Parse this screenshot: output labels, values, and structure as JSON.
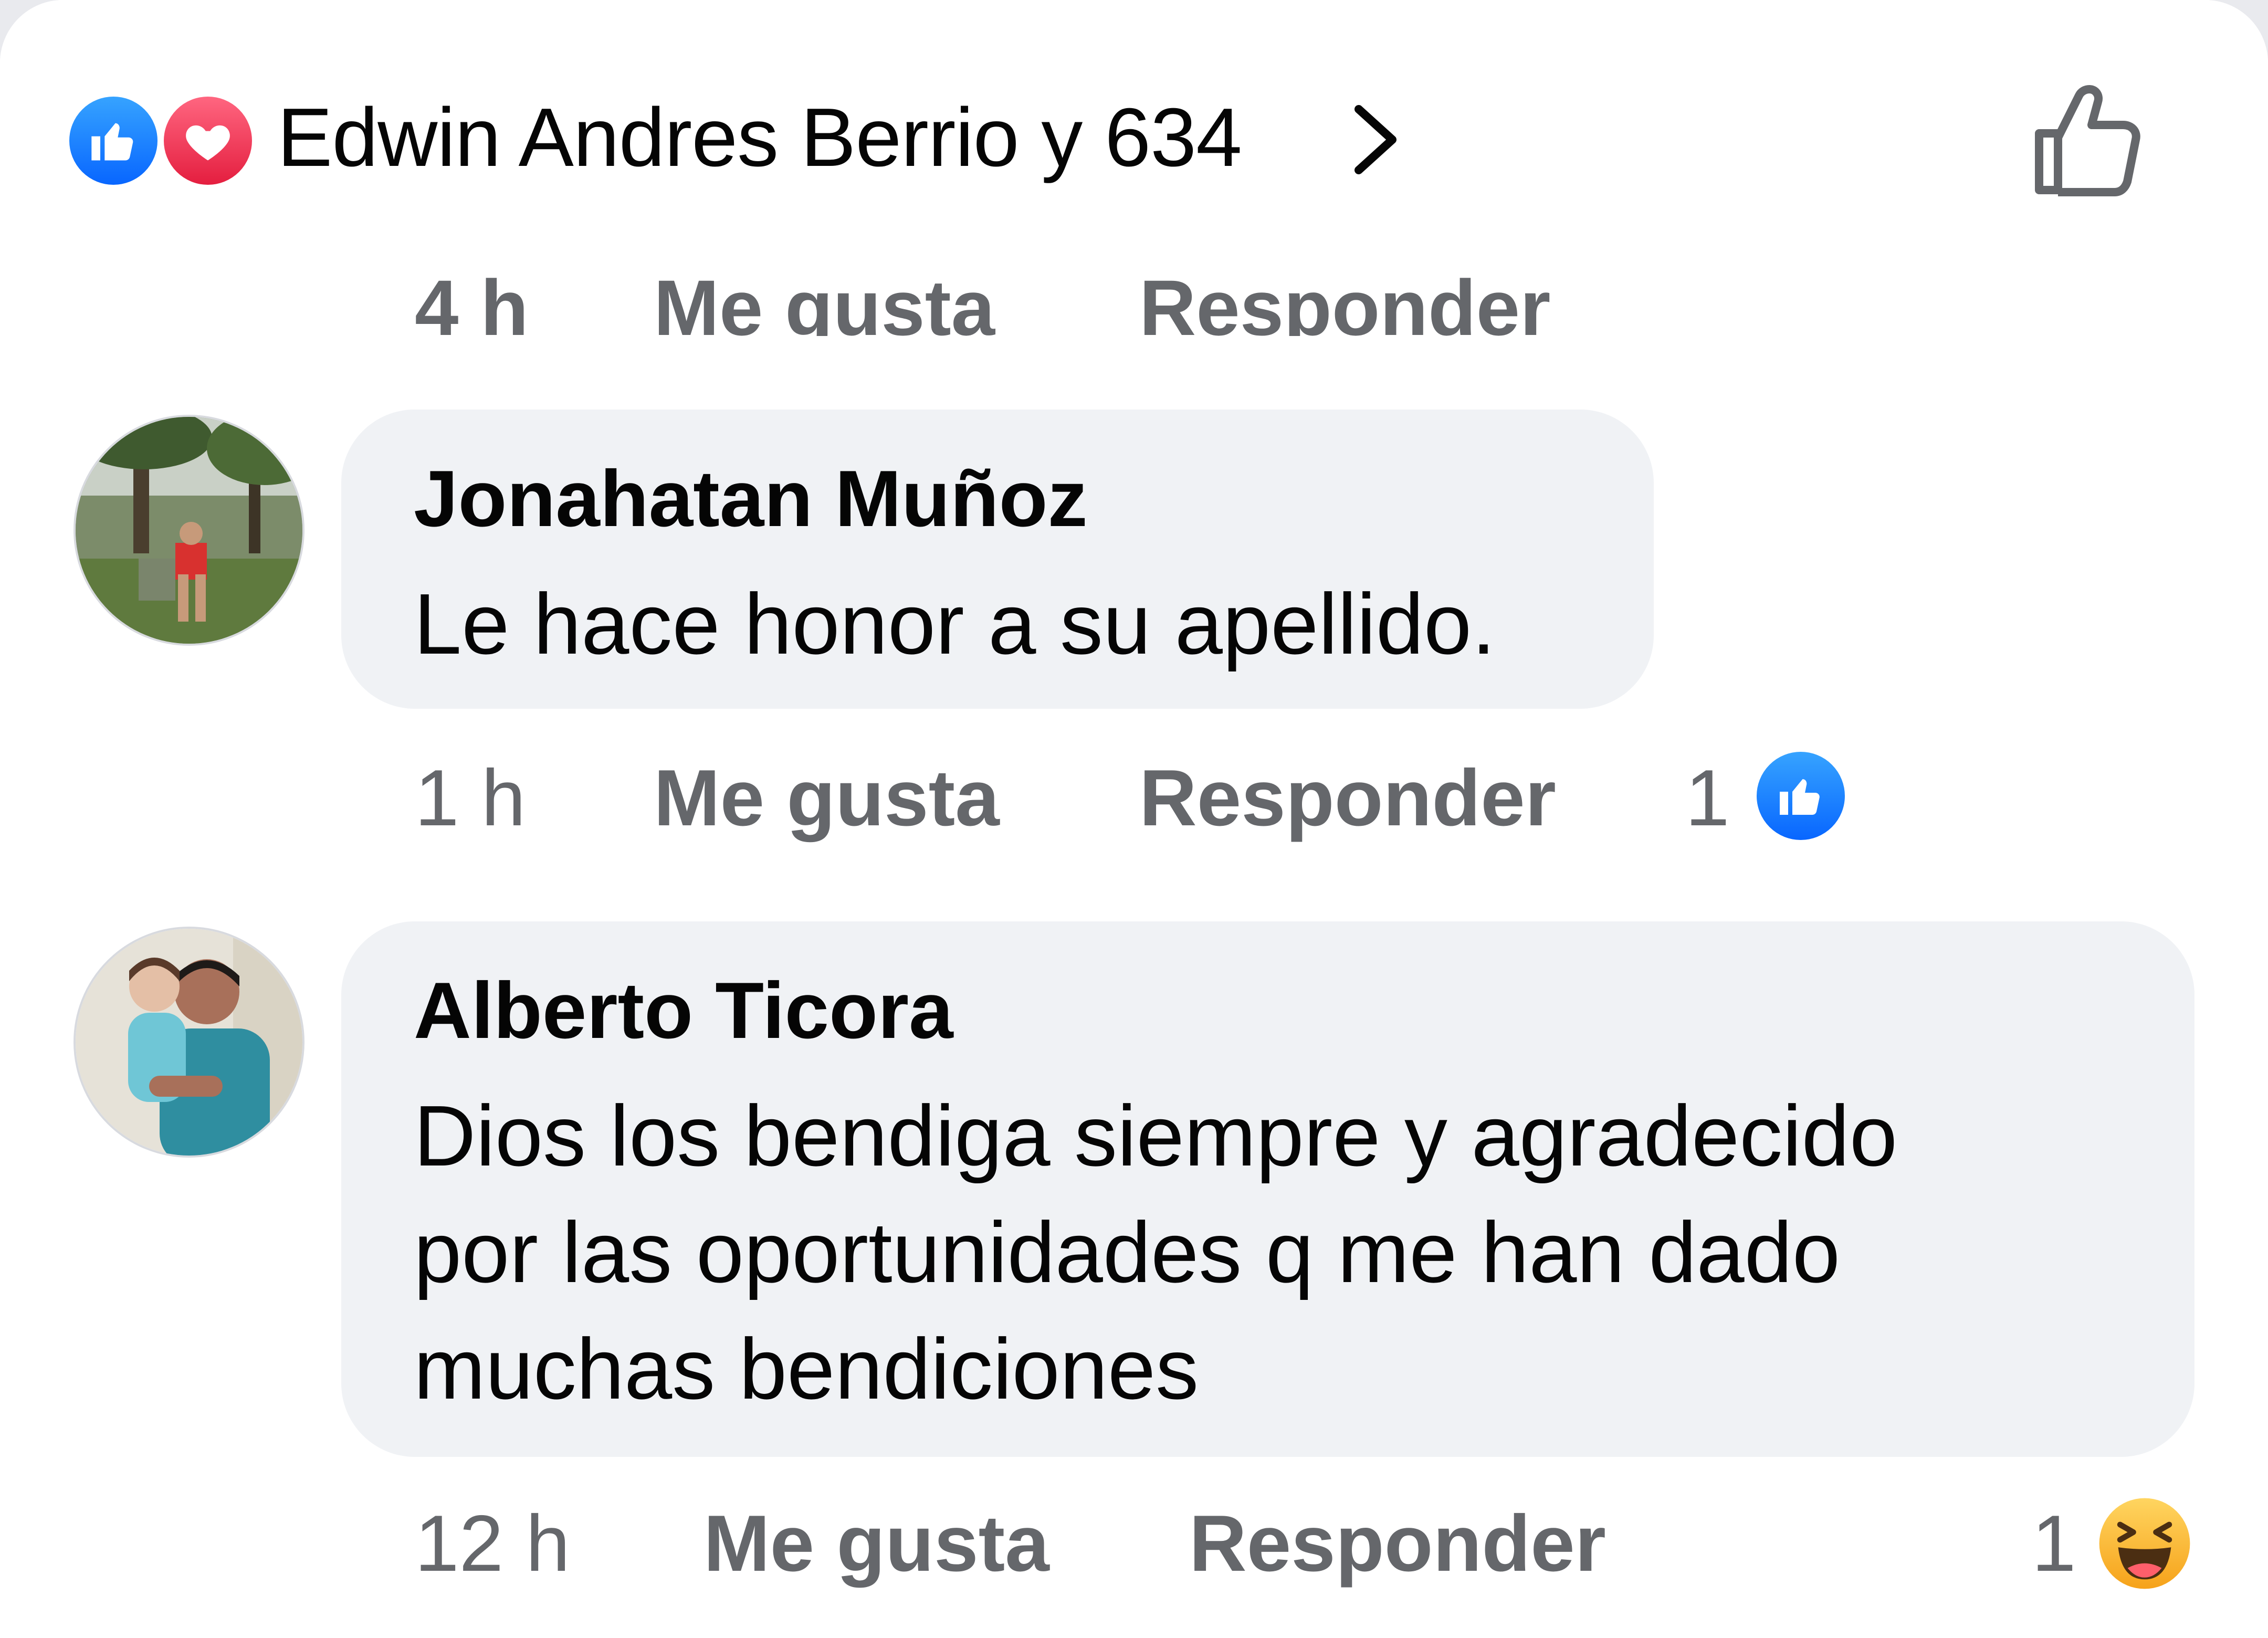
{
  "header": {
    "reactions": [
      {
        "icon": "like-reaction-icon",
        "color": "#0866ff"
      },
      {
        "icon": "love-reaction-icon",
        "color": "#e41e3f"
      }
    ],
    "title": "Edwin Andres Berrio y 634",
    "chevron_icon": "chevron-right-icon",
    "like_button_icon": "thumbs-up-outline-icon"
  },
  "previous_comment_actions": {
    "time": "4 h",
    "like_label": "Me gusta",
    "reply_label": "Responder"
  },
  "comments": [
    {
      "author": "Jonahatan Muñoz",
      "text": "Le hace honor a su apellido.",
      "time": "1 h",
      "like_label": "Me gusta",
      "reply_label": "Responder",
      "reaction_count": "1",
      "reaction_icon": "like-reaction-icon"
    },
    {
      "author": "Alberto Ticora",
      "text_lines": [
        "Dios los bendiga siempre y agradecido",
        "por las oportunidades q me han dado",
        "muchas bendiciones"
      ],
      "time": "12 h",
      "like_label": "Me gusta",
      "reply_label": "Responder",
      "reaction_count": "1",
      "reaction_icon": "haha-reaction-icon"
    }
  ],
  "colors": {
    "bubble_bg": "#f0f2f5",
    "meta_text": "#65676b",
    "primary_text": "#050505",
    "accent_blue": "#0866ff"
  }
}
